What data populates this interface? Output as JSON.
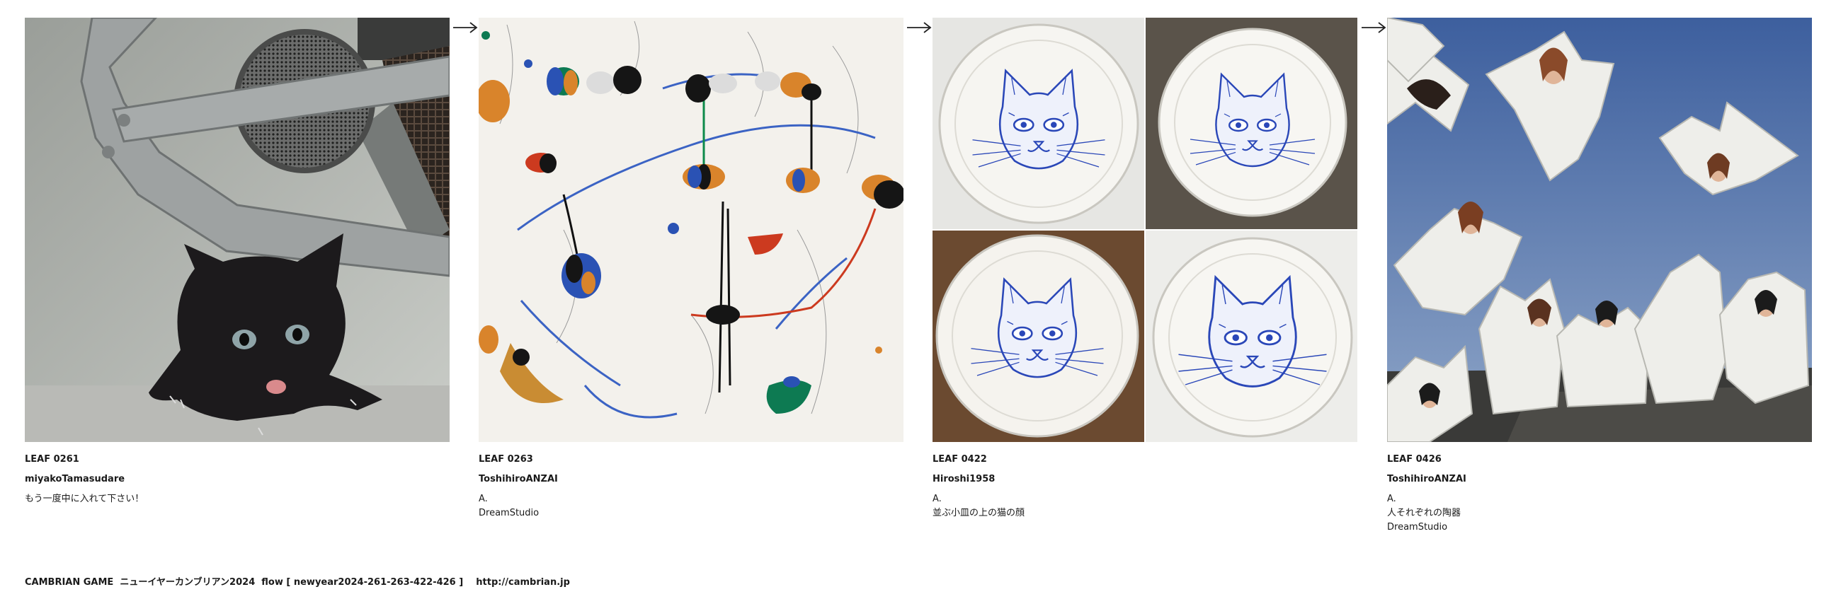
{
  "cards": [
    {
      "id": "LEAF 0261",
      "author": "miyakoTamasudare",
      "lines": [
        "もう一度中に入れて下さい！"
      ],
      "image": "black kitten crouching on concrete under a metal frame, drain grate in background"
    },
    {
      "id": "LEAF 0263",
      "author": "ToshihiroANZAI",
      "lines": [
        "A.",
        "DreamStudio"
      ],
      "image": "abstract painting with colorful blobs and thin lines on white"
    },
    {
      "id": "LEAF 0422",
      "author": "Hiroshi1958",
      "lines": [
        "A.",
        "並ぶ小皿の上の猫の顔"
      ],
      "image": "four white plates with blue line-drawn cat faces"
    },
    {
      "id": "LEAF 0426",
      "author": "ToshihiroANZAI",
      "lines": [
        "A.",
        "人それぞれの陶器",
        "DreamStudio"
      ],
      "image": "white folded paper-like vessels holding painted faces against a blue sky"
    }
  ],
  "icons": {
    "arrow": "right-arrow-icon"
  },
  "footer": {
    "text": "CAMBRIAN GAME  ニューイヤーカンブリアン2024  flow [ newyear2024-261-263-422-426 ]    http://cambrian.jp"
  },
  "colors": {
    "plate_ink": "#2a47b8",
    "sky": "#4d6fa8",
    "kitten": "#1c1a1c"
  }
}
